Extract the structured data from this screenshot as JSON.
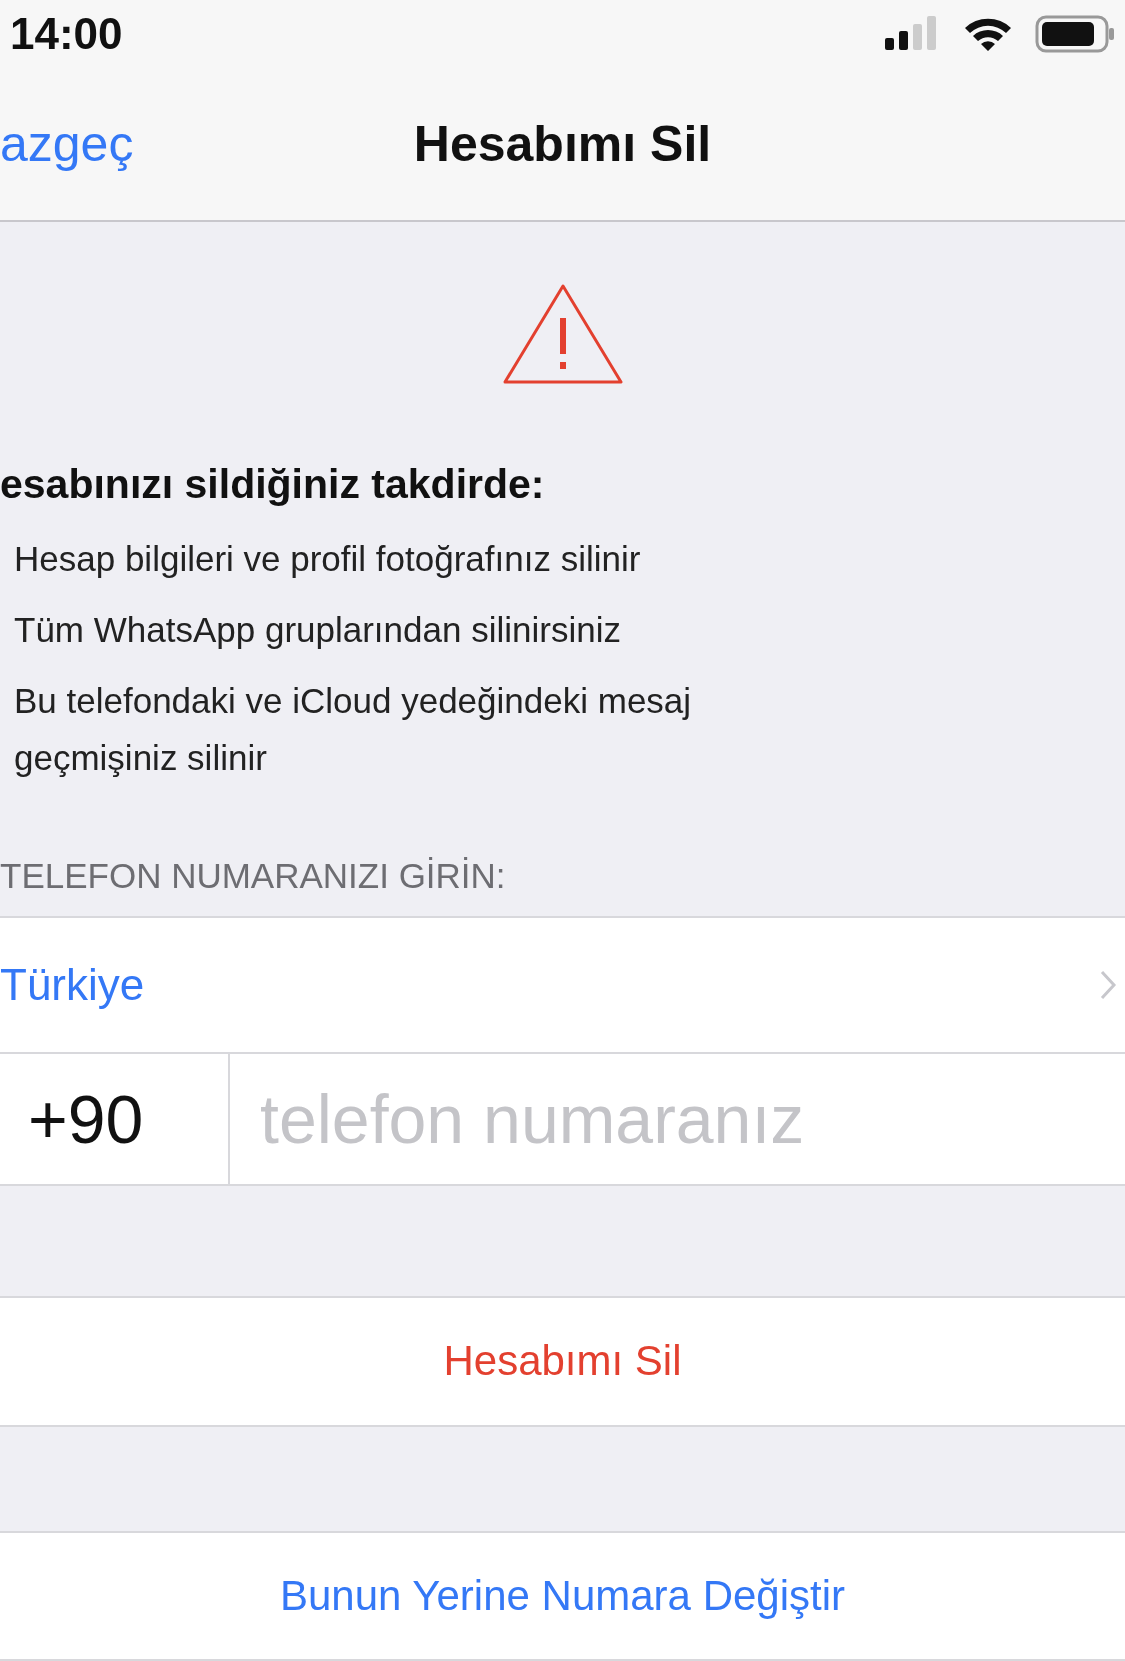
{
  "status_bar": {
    "time": "14:00"
  },
  "nav": {
    "cancel": "azgeç",
    "title": "Hesabımı Sil"
  },
  "warning": {
    "heading": "esabınızı sildiğiniz takdirde:",
    "items": [
      "Hesap bilgileri ve profil fotoğrafınız silinir",
      "Tüm WhatsApp gruplarından silinirsiniz",
      "Bu telefondaki ve iCloud yedeğindeki mesaj geçmişiniz silinir"
    ]
  },
  "section_label": "TELEFON NUMARANIZI GİRİN:",
  "country": "Türkiye",
  "phone": {
    "code": "+90",
    "placeholder": "telefon numaranız"
  },
  "buttons": [
    {
      "label": "Hesabımı Sil",
      "kind": "destructive"
    },
    {
      "label": "Bunun Yerine Numara Değiştir",
      "kind": "normal"
    }
  ]
}
